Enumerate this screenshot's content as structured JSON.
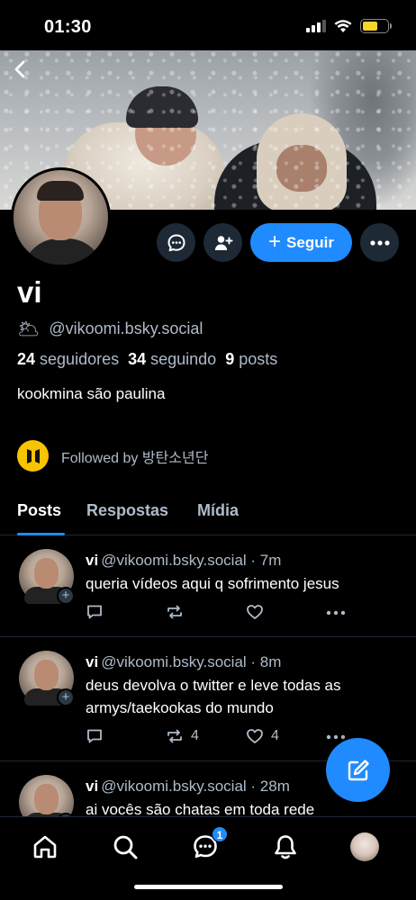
{
  "status_bar": {
    "time": "01:30",
    "battery_color": "#f6d32d"
  },
  "profile": {
    "display_name": "vi",
    "handle_emoji": "🌥",
    "handle": "@vikoomi.bsky.social",
    "followers_count": "24",
    "followers_label": "seguidores",
    "following_count": "34",
    "following_label": "seguindo",
    "posts_count": "9",
    "posts_label": "posts",
    "bio": "kookmina são paulina",
    "followed_by": "Followed by 방탄소년단"
  },
  "actions": {
    "follow_label": "Seguir"
  },
  "tabs": [
    {
      "label": "Posts",
      "active": true
    },
    {
      "label": "Respostas",
      "active": false
    },
    {
      "label": "Mídia",
      "active": false
    }
  ],
  "posts": [
    {
      "name": "vi",
      "meta": "@vikoomi.bsky.social · 7m",
      "text": "queria vídeos aqui q sofrimento jesus",
      "reposts": "",
      "likes": ""
    },
    {
      "name": "vi",
      "meta": "@vikoomi.bsky.social · 8m",
      "text": "deus devolva o twitter e leve todas as armys/taekookas do mundo",
      "reposts": "4",
      "likes": "4"
    },
    {
      "name": "vi",
      "meta": "@vikoomi.bsky.social · 28m",
      "text": "ai vocês são chatas em toda rede",
      "reposts": "",
      "likes": ""
    }
  ],
  "bottom_nav": {
    "chat_badge": "1"
  },
  "colors": {
    "accent": "#208bfe",
    "background": "#000000",
    "muted_text": "#aebbc9",
    "button_bg": "#1e2936"
  }
}
